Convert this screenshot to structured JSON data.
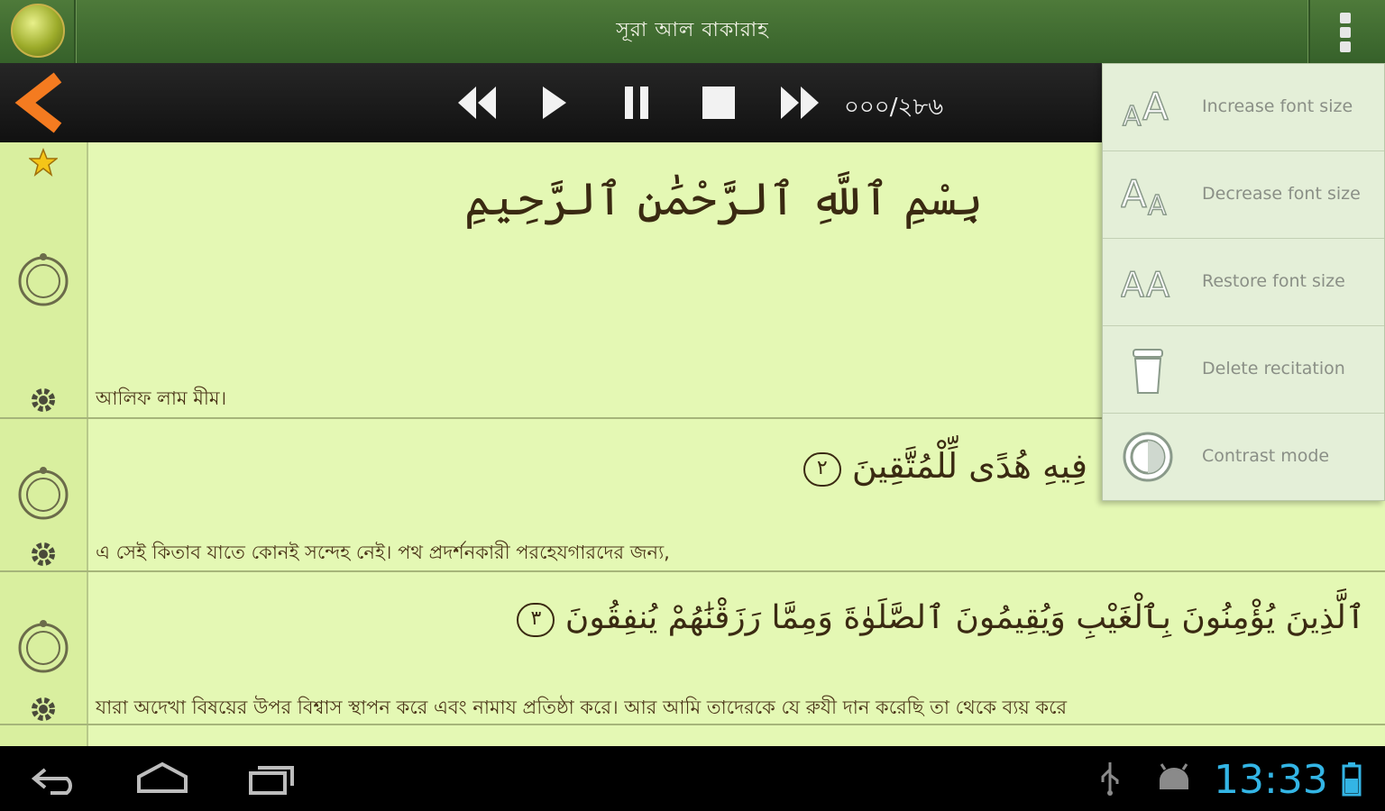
{
  "header": {
    "title": "সূরা আল বাকারাহ"
  },
  "player": {
    "counter": "০০০/২৮৬"
  },
  "verses": [
    {
      "arabic": "بِسْمِ ٱللَّهِ ٱلرَّحْمَٰنِ ٱلرَّحِيمِ",
      "translation": "আলিফ লাম মীম।"
    },
    {
      "arabic": "فِيهِ هُدًى لِّلْمُتَّقِينَ",
      "number": "٢",
      "translation": "এ সেই কিতাব যাতে কোনই সন্দেহ নেই। পথ প্রদর্শনকারী পরহেযগারদের জন্য,"
    },
    {
      "arabic": "ٱلَّذِينَ يُؤْمِنُونَ بِٱلْغَيْبِ وَيُقِيمُونَ ٱلصَّلَوٰةَ وَمِمَّا رَزَقْنَٰهُمْ يُنفِقُونَ",
      "number": "٣",
      "translation": "যারা অদেখা বিষয়ের উপর বিশ্বাস স্থাপন করে এবং নামায প্রতিষ্ঠা করে। আর আমি তাদেরকে যে রুযী দান করেছি তা থেকে ব্যয় করে"
    }
  ],
  "menu": {
    "items": [
      {
        "label": "Increase font size",
        "icon": "font-increase-icon"
      },
      {
        "label": "Decrease font size",
        "icon": "font-decrease-icon"
      },
      {
        "label": "Restore font size",
        "icon": "font-restore-icon"
      },
      {
        "label": "Delete recitation",
        "icon": "trash-icon"
      },
      {
        "label": "Contrast mode",
        "icon": "contrast-icon"
      }
    ]
  },
  "status": {
    "time": "13:33"
  },
  "colors": {
    "header_green": "#3f6b30",
    "page_background": "#e4f8b4",
    "clock_blue": "#33b5e5",
    "back_arrow_orange": "#f47b20"
  }
}
